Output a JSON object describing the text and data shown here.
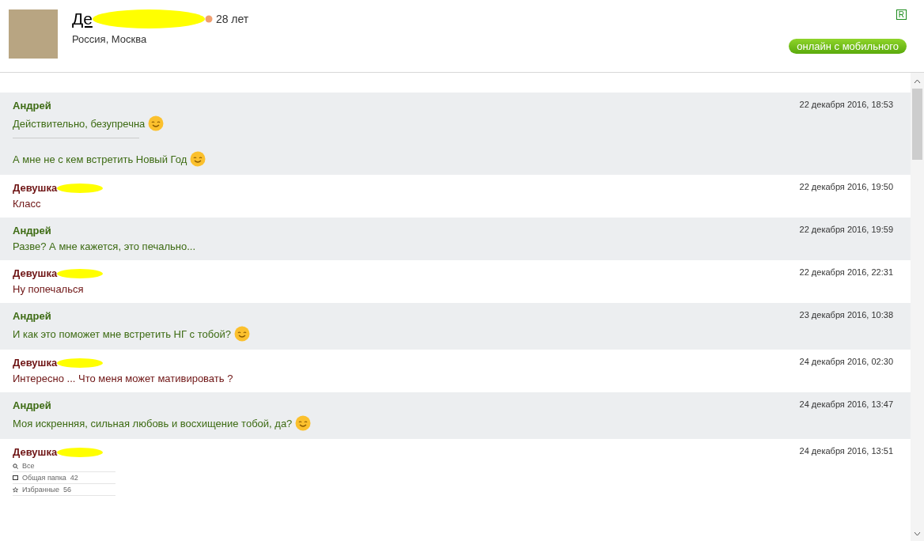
{
  "profile": {
    "name": "Де",
    "name_redacted": true,
    "age": "28 лет",
    "location": "Россия, Москва",
    "badge": "R",
    "status": "онлайн с мобильного"
  },
  "messages": [
    {
      "kind": "him",
      "author": "Андрей",
      "time": "22 декабря 2016, 18:53",
      "lines": [
        {
          "text": "Действительно, безупречна",
          "smiley": true
        },
        {
          "text": "А мне не с кем встретить Новый Год",
          "smiley": true
        }
      ]
    },
    {
      "kind": "her",
      "author": "Девушка",
      "redacted": true,
      "time": "22 декабря 2016, 19:50",
      "lines": [
        {
          "text": "Класс",
          "smiley": false
        }
      ]
    },
    {
      "kind": "him",
      "author": "Андрей",
      "time": "22 декабря 2016, 19:59",
      "lines": [
        {
          "text": "Разве? А мне кажется, это печально...",
          "smiley": false
        }
      ]
    },
    {
      "kind": "her",
      "author": "Девушка",
      "redacted": true,
      "time": "22 декабря 2016, 22:31",
      "lines": [
        {
          "text": "Ну попечалься",
          "smiley": false
        }
      ]
    },
    {
      "kind": "him",
      "author": "Андрей",
      "time": "23 декабря 2016, 10:38",
      "lines": [
        {
          "text": "И как это поможет мне встретить НГ с тобой?",
          "smiley": true
        }
      ]
    },
    {
      "kind": "her",
      "author": "Девушка",
      "redacted": true,
      "time": "24 декабря 2016, 02:30",
      "lines": [
        {
          "text": "Интересно ... Что меня может мативировать ?",
          "smiley": false
        }
      ]
    },
    {
      "kind": "him",
      "author": "Андрей",
      "time": "24 декабря 2016, 13:47",
      "lines": [
        {
          "text": "Моя искренняя, сильная любовь и восхищение тобой, да?",
          "smiley": true
        }
      ]
    },
    {
      "kind": "her",
      "author": "Девушка",
      "redacted": true,
      "time": "24 декабря 2016, 13:51",
      "attachment": [
        {
          "label": "Все"
        },
        {
          "label": "Общая папка",
          "count": "42"
        },
        {
          "label": "Избранные",
          "count": "56"
        }
      ]
    }
  ]
}
